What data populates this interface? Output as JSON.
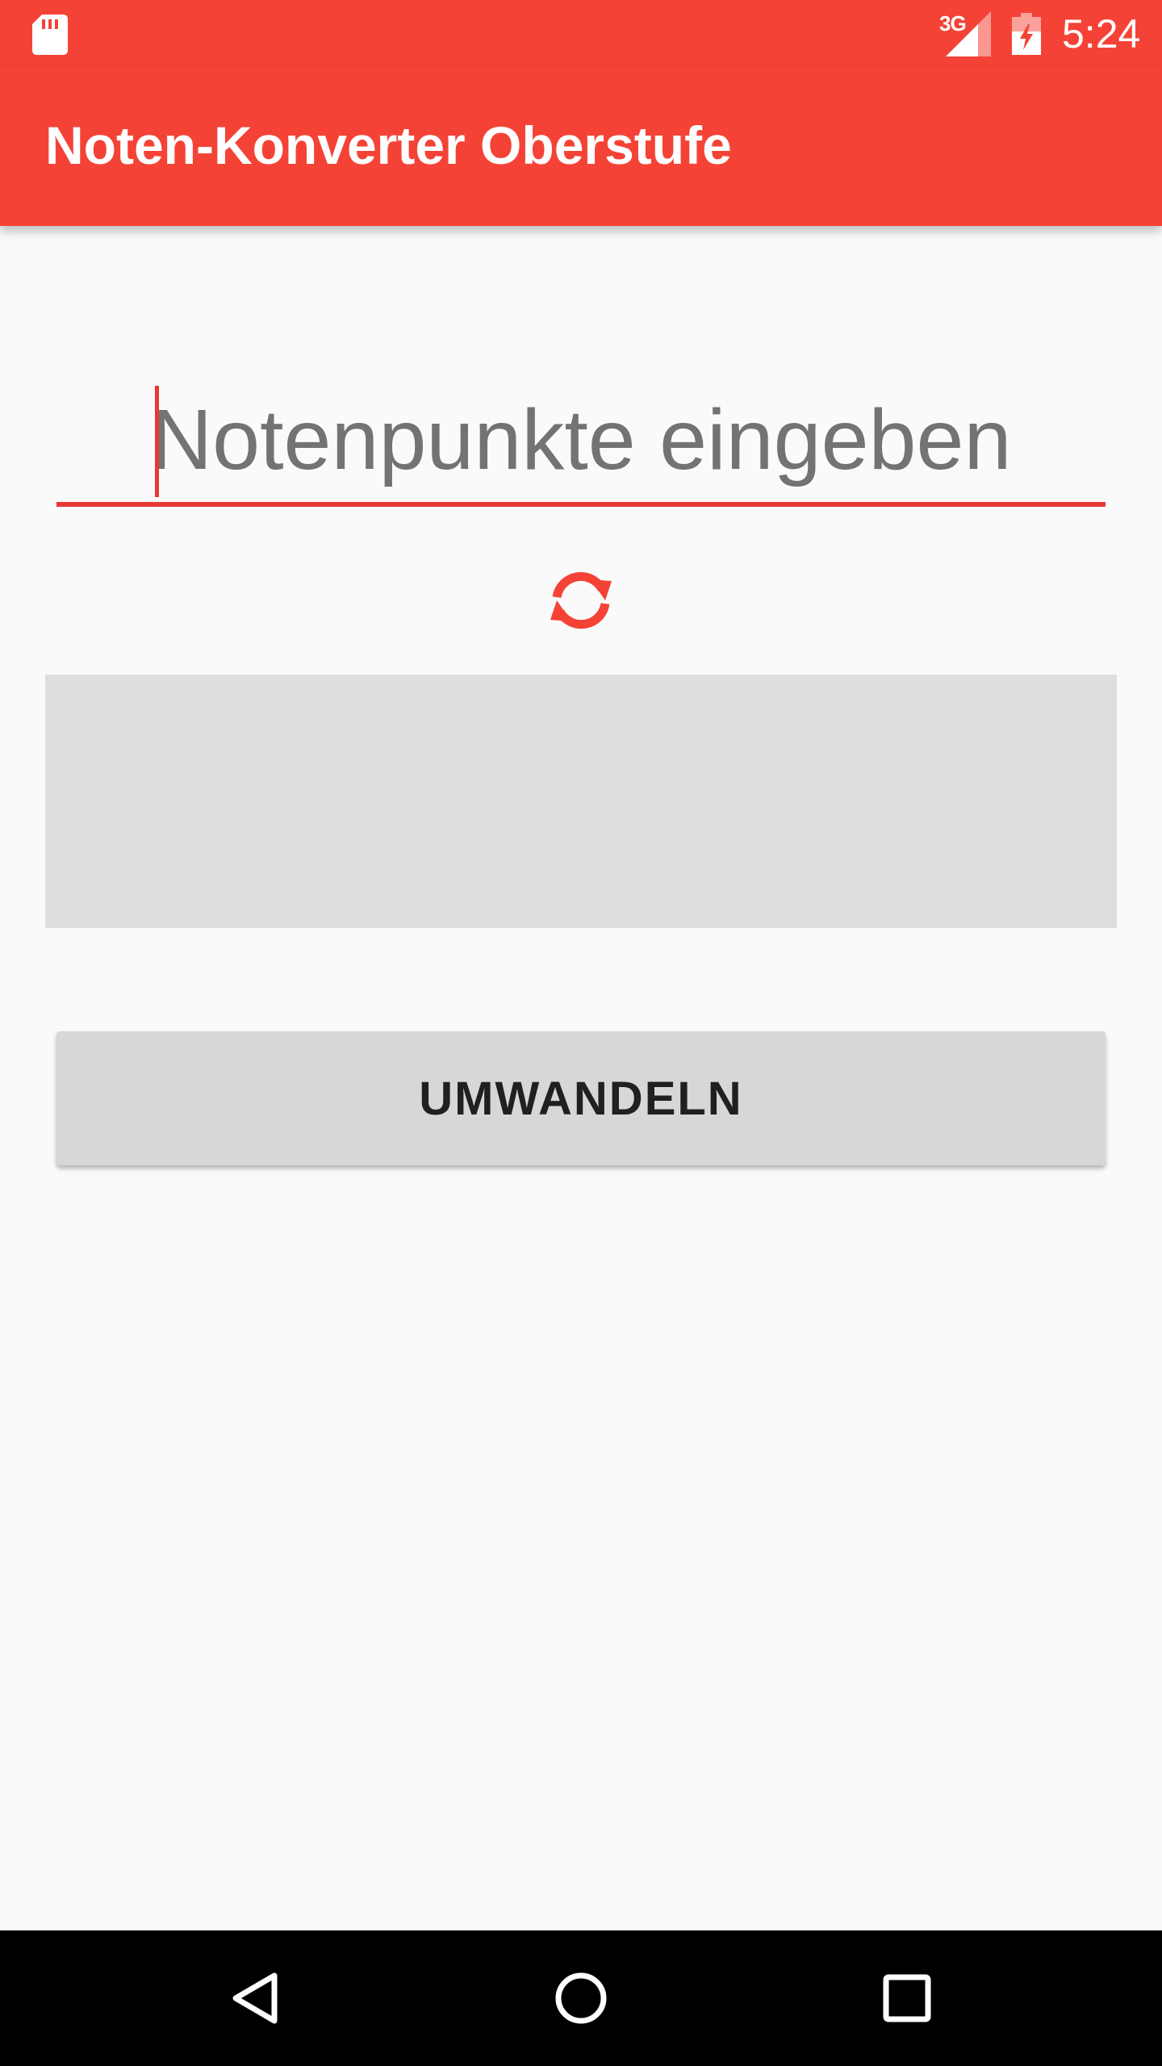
{
  "status_bar": {
    "network_type": "3G",
    "time": "5:24",
    "icons": [
      "sd-card-icon",
      "signal-icon",
      "battery-charging-icon"
    ]
  },
  "app_bar": {
    "title": "Noten-Konverter Oberstufe",
    "color": "#f44336"
  },
  "main": {
    "input": {
      "placeholder": "Notenpunkte eingeben",
      "value": ""
    },
    "refresh_icon": "refresh-icon",
    "result_text": "",
    "convert_button_label": "UMWANDELN"
  },
  "nav_bar": {
    "icons": [
      "back-icon",
      "home-icon",
      "recents-icon"
    ]
  },
  "colors": {
    "accent": "#f44336",
    "underline": "#e53935",
    "result_background": "#dedede",
    "button_background": "#d6d7d7",
    "page_background": "#fafafa"
  }
}
